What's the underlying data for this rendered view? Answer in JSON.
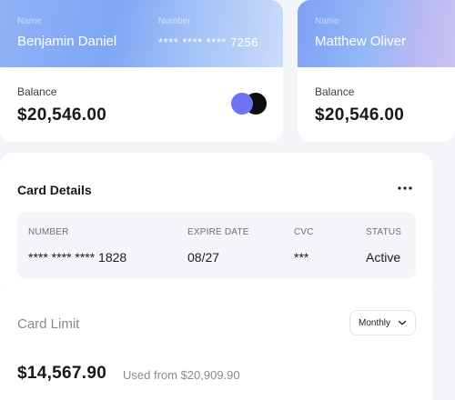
{
  "cards": [
    {
      "name_label": "Name",
      "name": "Benjamin Daniel",
      "number_label": "Number",
      "number": "**** **** **** 7256",
      "balance_label": "Balance",
      "balance": "$20,546.00",
      "brand_colors": [
        "#6c74f3",
        "#0b0b10"
      ]
    },
    {
      "name_label": "Name",
      "name": "Matthew Oliver",
      "balance_label": "Balance",
      "balance": "$20,546.00"
    }
  ],
  "card_details": {
    "title": "Card Details",
    "more_icon": "more-horizontal-icon",
    "columns": [
      "NUMBER",
      "EXPIRE DATE",
      "CVC",
      "STATUS"
    ],
    "values": [
      "**** **** **** 1828",
      "08/27",
      "***",
      "Active"
    ]
  },
  "card_limit": {
    "title": "Card Limit",
    "period": "Monthly",
    "amount": "$14,567.90",
    "used_text": "Used from $20,909.90"
  }
}
